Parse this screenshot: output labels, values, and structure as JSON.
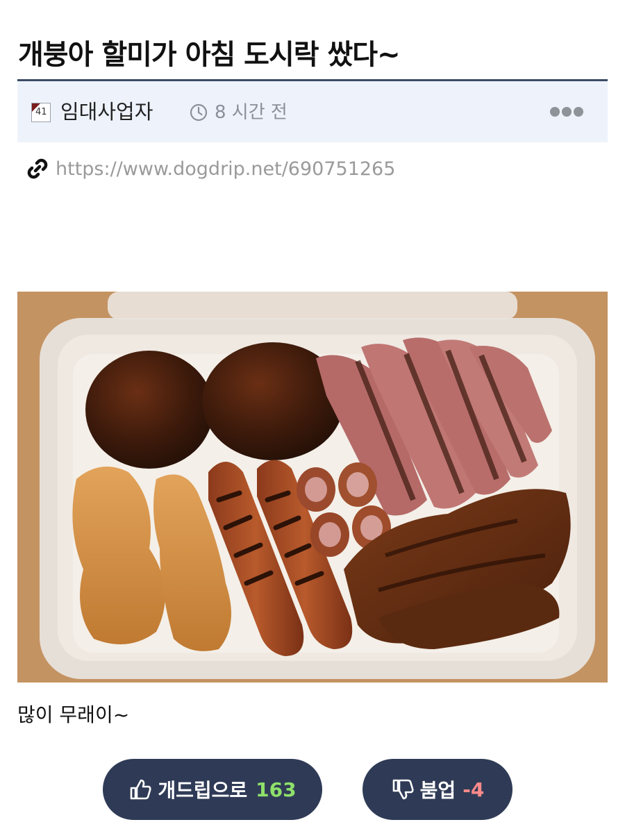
{
  "post": {
    "title": "개붕아 할미가 아침 도시락 쌌다~",
    "author": "임대사업자",
    "author_level": "41",
    "time_ago": "8 시간 전",
    "permalink": "https://www.dogdrip.net/690751265",
    "body_text": "많이 무래이~"
  },
  "votes": {
    "up_label": "개드립으로",
    "up_count": "163",
    "down_label": "붐업",
    "down_count": "-4"
  },
  "icons": {
    "clock": "clock-icon",
    "more": "more-dots-icon",
    "link": "link-icon",
    "thumbs_up": "thumbs-up-icon",
    "thumbs_down": "thumbs-down-icon"
  },
  "colors": {
    "header_rule": "#3b4a66",
    "meta_bg": "#eef3fb",
    "button_bg": "#2f3b56",
    "up_count": "#8ee06a",
    "down_count": "#ff8a8a"
  }
}
